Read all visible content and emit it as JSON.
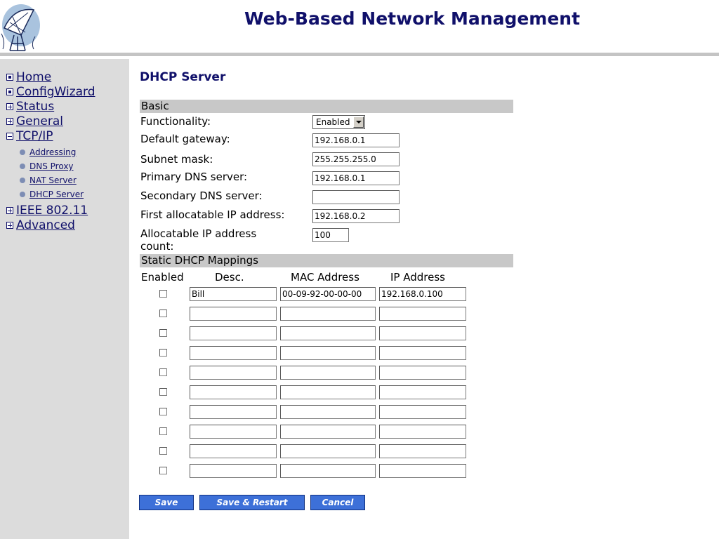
{
  "header": {
    "title": "Web-Based Network Management"
  },
  "sidebar": {
    "items": [
      {
        "label": "Home",
        "marker": "dot-box-icon"
      },
      {
        "label": "ConfigWizard",
        "marker": "dot-box-icon"
      },
      {
        "label": "Status",
        "marker": "plus-box-icon"
      },
      {
        "label": "General",
        "marker": "plus-box-icon"
      },
      {
        "label": "TCP/IP",
        "marker": "minus-box-icon"
      },
      {
        "label": "IEEE 802.11",
        "marker": "plus-box-icon"
      },
      {
        "label": "Advanced",
        "marker": "plus-box-icon"
      }
    ],
    "sub_items": [
      {
        "label": "Addressing"
      },
      {
        "label": "DNS Proxy"
      },
      {
        "label": "NAT Server"
      },
      {
        "label": "DHCP Server"
      }
    ]
  },
  "main": {
    "title": "DHCP Server",
    "basic": {
      "section_label": "Basic",
      "functionality_label": "Functionality:",
      "functionality_value": "Enabled",
      "gateway_label": "Default gateway:",
      "gateway_value": "192.168.0.1",
      "subnet_label": "Subnet mask:",
      "subnet_value": "255.255.255.0",
      "primary_dns_label": "Primary DNS server:",
      "primary_dns_value": "192.168.0.1",
      "secondary_dns_label": "Secondary DNS server:",
      "secondary_dns_value": "",
      "first_ip_label": "First allocatable IP address:",
      "first_ip_value": "192.168.0.2",
      "count_label_line1": "Allocatable IP address",
      "count_label_line2": "count:",
      "count_value": "100"
    },
    "mappings": {
      "section_label": "Static DHCP Mappings",
      "columns": [
        "Enabled",
        "Desc.",
        "MAC Address",
        "IP Address"
      ],
      "rows": [
        {
          "enabled": false,
          "desc": "Bill",
          "mac": "00-09-92-00-00-00",
          "ip": "192.168.0.100"
        },
        {
          "enabled": false,
          "desc": "",
          "mac": "",
          "ip": ""
        },
        {
          "enabled": false,
          "desc": "",
          "mac": "",
          "ip": ""
        },
        {
          "enabled": false,
          "desc": "",
          "mac": "",
          "ip": ""
        },
        {
          "enabled": false,
          "desc": "",
          "mac": "",
          "ip": ""
        },
        {
          "enabled": false,
          "desc": "",
          "mac": "",
          "ip": ""
        },
        {
          "enabled": false,
          "desc": "",
          "mac": "",
          "ip": ""
        },
        {
          "enabled": false,
          "desc": "",
          "mac": "",
          "ip": ""
        },
        {
          "enabled": false,
          "desc": "",
          "mac": "",
          "ip": ""
        },
        {
          "enabled": false,
          "desc": "",
          "mac": "",
          "ip": ""
        }
      ]
    },
    "buttons": {
      "save": "Save",
      "save_restart": "Save & Restart",
      "cancel": "Cancel"
    }
  },
  "colors": {
    "brand_navy": "#10106a",
    "sidebar_bg": "#dcdcdc",
    "section_bar": "#c8c8c8",
    "button_blue": "#3d70d8",
    "bullet": "#7d8db4"
  }
}
